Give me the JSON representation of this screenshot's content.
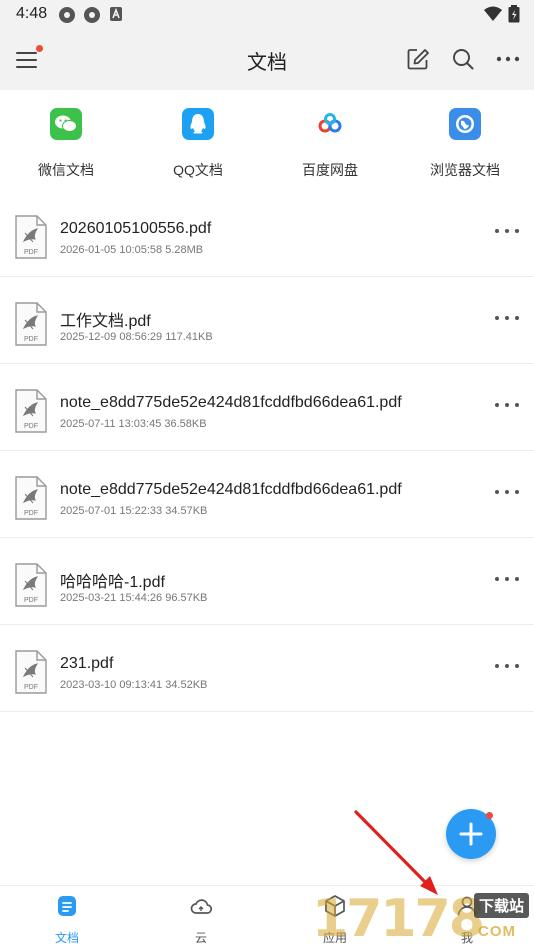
{
  "status_bar": {
    "time": "4:48"
  },
  "header": {
    "title": "文档"
  },
  "quick_access": [
    {
      "label": "微信文档",
      "icon": "wechat-icon",
      "color": "#3cc14a"
    },
    {
      "label": "QQ文档",
      "icon": "qq-icon",
      "color": "#1da1f2"
    },
    {
      "label": "百度网盘",
      "icon": "baidu-netdisk-icon",
      "color": "#ffffff"
    },
    {
      "label": "浏览器文档",
      "icon": "browser-icon",
      "color": "#3a8de8"
    }
  ],
  "files": [
    {
      "name": "20260105100556.pdf",
      "meta": "2026-01-05 10:05:58 5.28MB",
      "icon_label": "PDF"
    },
    {
      "name": "工作文档.pdf",
      "meta": "2025-12-09 08:56:29 117.41KB",
      "icon_label": "PDF"
    },
    {
      "name": "note_e8dd775de52e424d81fcddfbd66dea61.pdf",
      "meta": "2025-07-11 13:03:45 36.58KB",
      "icon_label": "PDF"
    },
    {
      "name": "note_e8dd775de52e424d81fcddfbd66dea61.pdf",
      "meta": "2025-07-01 15:22:33 34.57KB",
      "icon_label": "PDF"
    },
    {
      "name": "哈哈哈哈-1.pdf",
      "meta": "2025-03-21 15:44:26 96.57KB",
      "icon_label": "PDF"
    },
    {
      "name": "231.pdf",
      "meta": "2023-03-10 09:13:41 34.52KB",
      "icon_label": "PDF"
    }
  ],
  "bottom_nav": [
    {
      "label": "文档",
      "icon": "document-icon",
      "active": true
    },
    {
      "label": "云",
      "icon": "cloud-icon",
      "active": false
    },
    {
      "label": "应用",
      "icon": "apps-icon",
      "active": false
    },
    {
      "label": "我",
      "icon": "user-icon",
      "active": false
    }
  ],
  "watermark": {
    "digits": "17178",
    "badge": "下载站",
    "domain": "COM"
  },
  "colors": {
    "accent": "#2b9af3",
    "badge_red": "#f04a3b",
    "header_bg": "#f2f2f2"
  }
}
